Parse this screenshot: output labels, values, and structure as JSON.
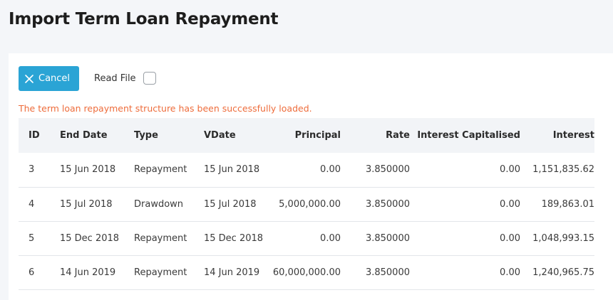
{
  "page": {
    "title": "Import Term Loan Repayment"
  },
  "toolbar": {
    "cancel_label": "Cancel",
    "read_file_label": "Read File",
    "read_file_checked": false
  },
  "message": "The term loan repayment structure has been successfully loaded.",
  "colors": {
    "accent": "#2aa4d5",
    "message": "#ee6c3b"
  },
  "table": {
    "headers": {
      "id": "ID",
      "end_date": "End Date",
      "type": "Type",
      "vdate": "VDate",
      "principal": "Principal",
      "rate": "Rate",
      "interest_capitalised": "Interest Capitalised",
      "interest": "Interest"
    },
    "rows": [
      {
        "id": "3",
        "end_date": "15 Jun 2018",
        "type": "Repayment",
        "vdate": "15 Jun 2018",
        "principal": "0.00",
        "rate": "3.850000",
        "interest_capitalised": "0.00",
        "interest": "1,151,835.62"
      },
      {
        "id": "4",
        "end_date": "15 Jul 2018",
        "type": "Drawdown",
        "vdate": "15 Jul 2018",
        "principal": "5,000,000.00",
        "rate": "3.850000",
        "interest_capitalised": "0.00",
        "interest": "189,863.01"
      },
      {
        "id": "5",
        "end_date": "15 Dec 2018",
        "type": "Repayment",
        "vdate": "15 Dec 2018",
        "principal": "0.00",
        "rate": "3.850000",
        "interest_capitalised": "0.00",
        "interest": "1,048,993.15"
      },
      {
        "id": "6",
        "end_date": "14 Jun 2019",
        "type": "Repayment",
        "vdate": "14 Jun 2019",
        "principal": "60,000,000.00",
        "rate": "3.850000",
        "interest_capitalised": "0.00",
        "interest": "1,240,965.75"
      }
    ]
  }
}
